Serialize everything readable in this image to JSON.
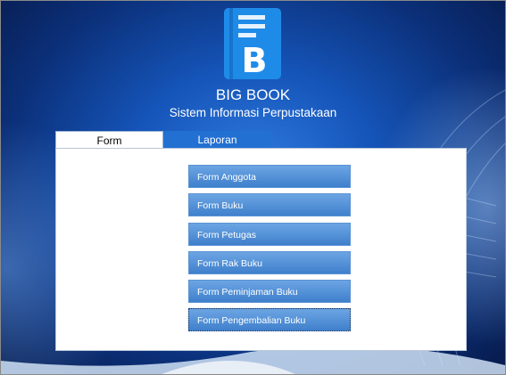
{
  "app": {
    "title": "BIG BOOK",
    "subtitle": "Sistem Informasi Perpustakaan"
  },
  "tabs": [
    {
      "label": "Form",
      "active": true
    },
    {
      "label": "Laporan",
      "active": false
    }
  ],
  "form_buttons": [
    "Form Anggota",
    "Form Buku",
    "Form Petugas",
    "Form Rak Buku",
    "Form Peminjaman Buku",
    "Form Pengembalian Buku"
  ],
  "logo": {
    "letter": "B",
    "icon": "book-icon"
  },
  "colors": {
    "accent": "#2270d2",
    "logo": "#1f8be8",
    "button": "#4f8ed6"
  }
}
